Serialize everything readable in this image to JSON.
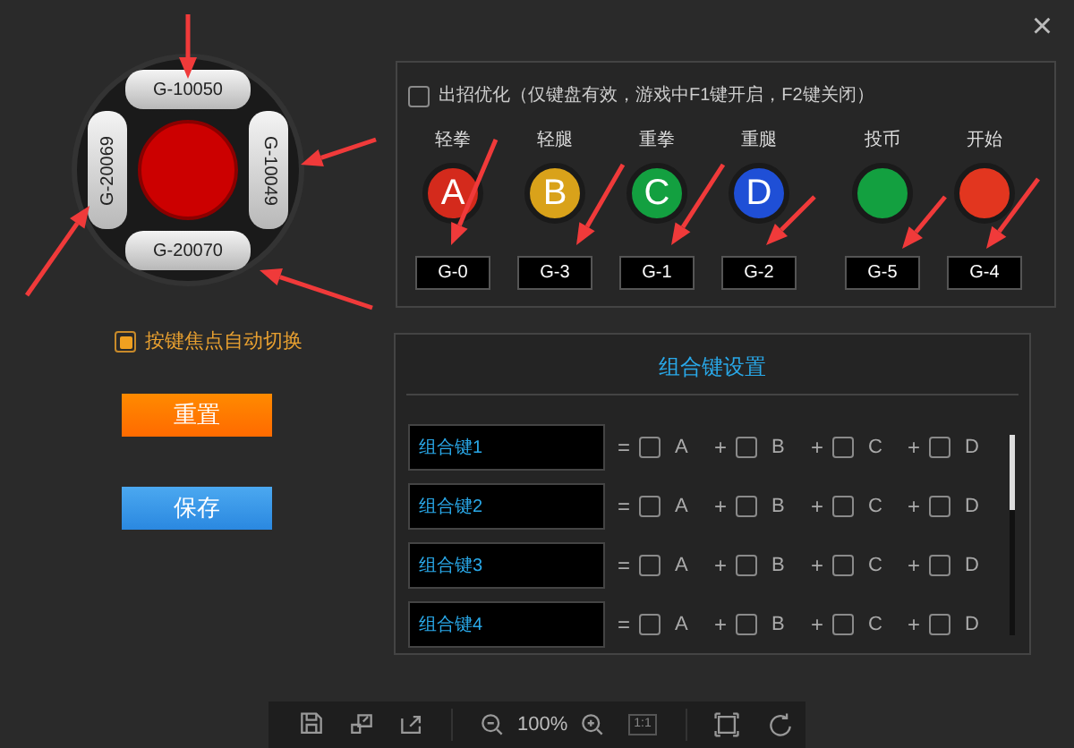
{
  "close": "×",
  "dpad": [
    {
      "kind": "up",
      "label": "G-10050"
    },
    {
      "kind": "right",
      "label": "G-10049"
    },
    {
      "kind": "down",
      "label": "G-20070"
    },
    {
      "kind": "left",
      "label": "G-20069"
    }
  ],
  "auto_switch": {
    "label": "按键焦点自动切换",
    "checked": true
  },
  "reset_button": "重置",
  "save_button": "保存",
  "optimize": {
    "label": "出招优化（仅键盘有效，游戏中F1键开启，F2键关闭）",
    "checked": false
  },
  "game_buttons": [
    {
      "label": "轻拳",
      "letter": "A",
      "color": "#d42a1c",
      "key": "G-0"
    },
    {
      "label": "轻腿",
      "letter": "B",
      "color": "#d9a21a",
      "key": "G-3"
    },
    {
      "label": "重拳",
      "letter": "C",
      "color": "#13a040",
      "key": "G-1"
    },
    {
      "label": "重腿",
      "letter": "D",
      "color": "#1f4fd6",
      "key": "G-2"
    },
    {
      "label": "投币",
      "color": "#13a040",
      "key": "G-5"
    },
    {
      "label": "开始",
      "color": "#e2361f",
      "key": "G-4"
    }
  ],
  "combo": {
    "title": "组合键设置",
    "rows": [
      {
        "name": "组合键1",
        "parts": [
          {
            "op": "=",
            "letter": "A",
            "checked": false
          },
          {
            "op": "+",
            "letter": "B",
            "checked": false
          },
          {
            "op": "+",
            "letter": "C",
            "checked": false
          },
          {
            "op": "+",
            "letter": "D",
            "checked": false
          }
        ]
      },
      {
        "name": "组合键2",
        "parts": [
          {
            "op": "=",
            "letter": "A",
            "checked": false
          },
          {
            "op": "+",
            "letter": "B",
            "checked": false
          },
          {
            "op": "+",
            "letter": "C",
            "checked": false
          },
          {
            "op": "+",
            "letter": "D",
            "checked": false
          }
        ]
      },
      {
        "name": "组合键3",
        "parts": [
          {
            "op": "=",
            "letter": "A",
            "checked": false
          },
          {
            "op": "+",
            "letter": "B",
            "checked": false
          },
          {
            "op": "+",
            "letter": "C",
            "checked": false
          },
          {
            "op": "+",
            "letter": "D",
            "checked": false
          }
        ]
      },
      {
        "name": "组合键4",
        "parts": [
          {
            "op": "=",
            "letter": "A",
            "checked": false
          },
          {
            "op": "+",
            "letter": "B",
            "checked": false
          },
          {
            "op": "+",
            "letter": "C",
            "checked": false
          },
          {
            "op": "+",
            "letter": "D",
            "checked": false
          }
        ]
      }
    ]
  },
  "toolbar": {
    "zoom": "100%",
    "actual_size": "1:1"
  }
}
